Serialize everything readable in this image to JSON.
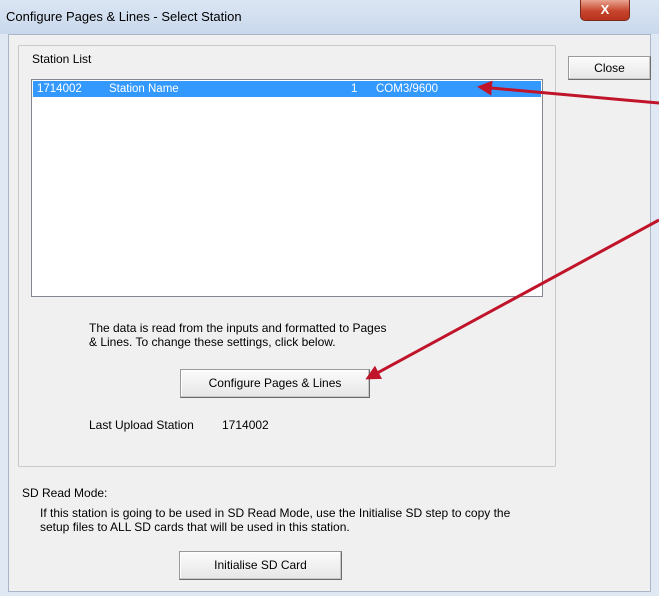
{
  "window": {
    "title": "Configure Pages & Lines - Select Station",
    "close_glyph": "X"
  },
  "station_list": {
    "label": "Station List",
    "rows": [
      {
        "id": "1714002",
        "name": "Station Name",
        "number": "1",
        "port": "COM3/9600"
      }
    ]
  },
  "buttons": {
    "close": "Close",
    "configure": "Configure Pages & Lines",
    "initialise": "Initialise SD Card"
  },
  "info": {
    "description": "The data is read from the inputs and formatted to Pages & Lines. To change these settings, click below.",
    "last_upload_label": "Last Upload Station",
    "last_upload_value": "1714002"
  },
  "sd": {
    "heading": "SD Read Mode:",
    "description": "If this station is going to be used in SD Read Mode, use the Initialise SD step to copy the setup files to ALL SD cards that will be used in this station."
  },
  "colors": {
    "selection": "#3399ff",
    "annotation_arrow": "#c0142a"
  }
}
